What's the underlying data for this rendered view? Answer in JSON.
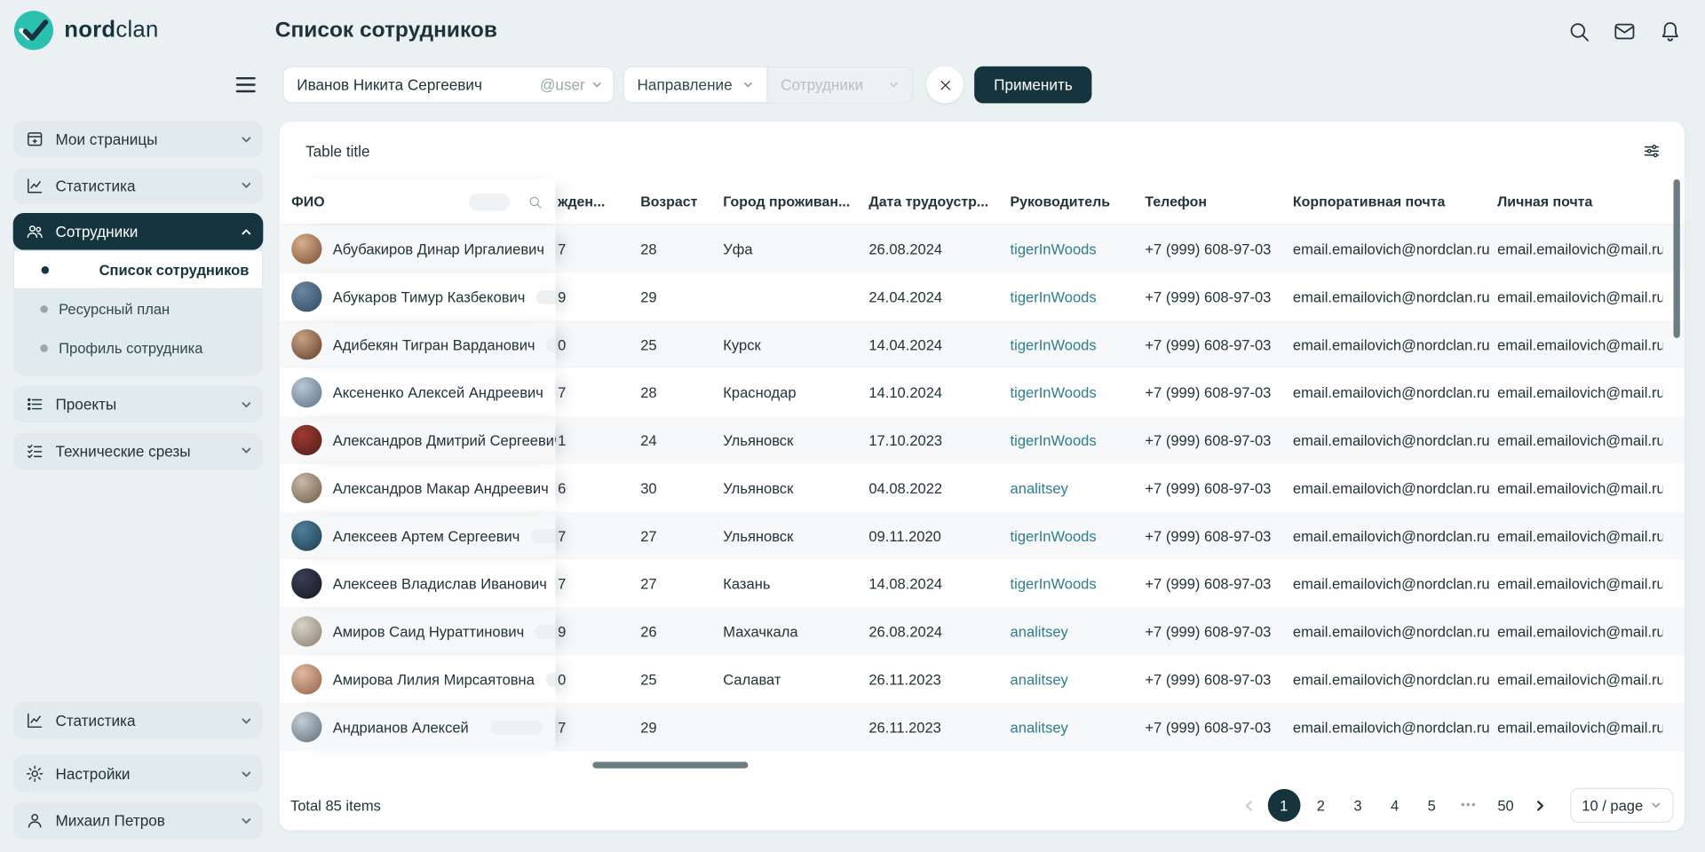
{
  "brand": {
    "bold": "nord",
    "light": "clan"
  },
  "topbar": {
    "title": "Список сотрудников"
  },
  "filters": {
    "user_value": "Иванов Никита Сергеевич",
    "user_addon": "@user",
    "direction": "Направление",
    "employees": "Сотрудники",
    "apply": "Применить"
  },
  "sidebar": {
    "items": [
      {
        "label": "Мои страницы",
        "icon": "pages-icon"
      },
      {
        "label": "Статистика",
        "icon": "stats-icon"
      },
      {
        "label": "Сотрудники",
        "icon": "employees-icon",
        "active": true,
        "children": [
          {
            "label": "Список сотрудников",
            "selected": true
          },
          {
            "label": "Ресурсный план",
            "selected": false
          },
          {
            "label": "Профиль сотрудника",
            "selected": false
          }
        ]
      },
      {
        "label": "Проекты",
        "icon": "projects-icon"
      },
      {
        "label": "Технические срезы",
        "icon": "tech-icon"
      }
    ],
    "bottom": [
      {
        "label": "Статистика",
        "icon": "stats-icon"
      },
      {
        "label": "Настройки",
        "icon": "gear-icon"
      },
      {
        "label": "Михаил Петров",
        "icon": "person-icon"
      }
    ]
  },
  "table": {
    "title": "Table title",
    "columns": {
      "name": "ФИО",
      "birth_clipped": "жден...",
      "age": "Возраст",
      "city": "Город проживан...",
      "hired": "Дата трудоустр...",
      "manager": "Руководитель",
      "phone": "Телефон",
      "corp_email": "Корпоративная почта",
      "personal_email": "Личная почта"
    },
    "rows": [
      {
        "name": "Абубакиров Динар Иргалиевич",
        "birth_fragment": "7",
        "age": "28",
        "city": "Уфа",
        "hired": "26.08.2024",
        "manager": "tigerInWoods",
        "phone": "+7 (999) 608-97-03",
        "corp_email": "email.emailovich@nordclan.ru",
        "personal_email": "email.emailovich@mail.ru"
      },
      {
        "name": "Абукаров Тимур Казбекович",
        "birth_fragment": "9",
        "age": "29",
        "city": "",
        "hired": "24.04.2024",
        "manager": "tigerInWoods",
        "phone": "+7 (999) 608-97-03",
        "corp_email": "email.emailovich@nordclan.ru",
        "personal_email": "email.emailovich@mail.ru"
      },
      {
        "name": "Адибекян Тигран Варданович",
        "birth_fragment": "0",
        "age": "25",
        "city": "Курск",
        "hired": "14.04.2024",
        "manager": "tigerInWoods",
        "phone": "+7 (999) 608-97-03",
        "corp_email": "email.emailovich@nordclan.ru",
        "personal_email": "email.emailovich@mail.ru"
      },
      {
        "name": "Аксененко Алексей Андреевич",
        "birth_fragment": "7",
        "age": "28",
        "city": "Краснодар",
        "hired": "14.10.2024",
        "manager": "tigerInWoods",
        "phone": "+7 (999) 608-97-03",
        "corp_email": "email.emailovich@nordclan.ru",
        "personal_email": "email.emailovich@mail.ru"
      },
      {
        "name": "Александров Дмитрий Сергеевич",
        "birth_fragment": "1",
        "age": "24",
        "city": "Ульяновск",
        "hired": "17.10.2023",
        "manager": "tigerInWoods",
        "phone": "+7 (999) 608-97-03",
        "corp_email": "email.emailovich@nordclan.ru",
        "personal_email": "email.emailovich@mail.ru"
      },
      {
        "name": "Александров Макар Андреевич",
        "birth_fragment": "6",
        "age": "30",
        "city": "Ульяновск",
        "hired": "04.08.2022",
        "manager": "analitsey",
        "phone": "+7 (999) 608-97-03",
        "corp_email": "email.emailovich@nordclan.ru",
        "personal_email": "email.emailovich@mail.ru"
      },
      {
        "name": "Алексеев Артем Сергеевич",
        "birth_fragment": "7",
        "age": "27",
        "city": "Ульяновск",
        "hired": "09.11.2020",
        "manager": "tigerInWoods",
        "phone": "+7 (999) 608-97-03",
        "corp_email": "email.emailovich@nordclan.ru",
        "personal_email": "email.emailovich@mail.ru"
      },
      {
        "name": "Алексеев Владислав Иванович",
        "birth_fragment": "7",
        "age": "27",
        "city": "Казань",
        "hired": "14.08.2024",
        "manager": "tigerInWoods",
        "phone": "+7 (999) 608-97-03",
        "corp_email": "email.emailovich@nordclan.ru",
        "personal_email": "email.emailovich@mail.ru"
      },
      {
        "name": "Амиров Саид Нураттинович",
        "birth_fragment": "9",
        "age": "26",
        "city": "Махачкала",
        "hired": "26.08.2024",
        "manager": "analitsey",
        "phone": "+7 (999) 608-97-03",
        "corp_email": "email.emailovich@nordclan.ru",
        "personal_email": "email.emailovich@mail.ru"
      },
      {
        "name": "Амирова Лилия Мирсаятовна",
        "birth_fragment": "0",
        "age": "25",
        "city": "Салават",
        "hired": "26.11.2023",
        "manager": "analitsey",
        "phone": "+7 (999) 608-97-03",
        "corp_email": "email.emailovich@nordclan.ru",
        "personal_email": "email.emailovich@mail.ru"
      },
      {
        "name": "Андрианов Алексей",
        "birth_fragment": "7",
        "age": "29",
        "city": "",
        "hired": "26.11.2023",
        "manager": "analitsey",
        "phone": "+7 (999) 608-97-03",
        "corp_email": "email.emailovich@nordclan.ru",
        "personal_email": "email.emailovich@mail.ru"
      }
    ]
  },
  "pagination": {
    "total": "Total 85 items",
    "pages": [
      "1",
      "2",
      "3",
      "4",
      "5",
      "•••",
      "50"
    ],
    "active": "1",
    "page_size": "10 / page"
  },
  "colors": {
    "accent_dark": "#15343d",
    "logo_teal": "#2cc0b0",
    "link": "#2e7d91",
    "stripe": "#f6f8f9",
    "page_bg": "#ebf1f3"
  }
}
